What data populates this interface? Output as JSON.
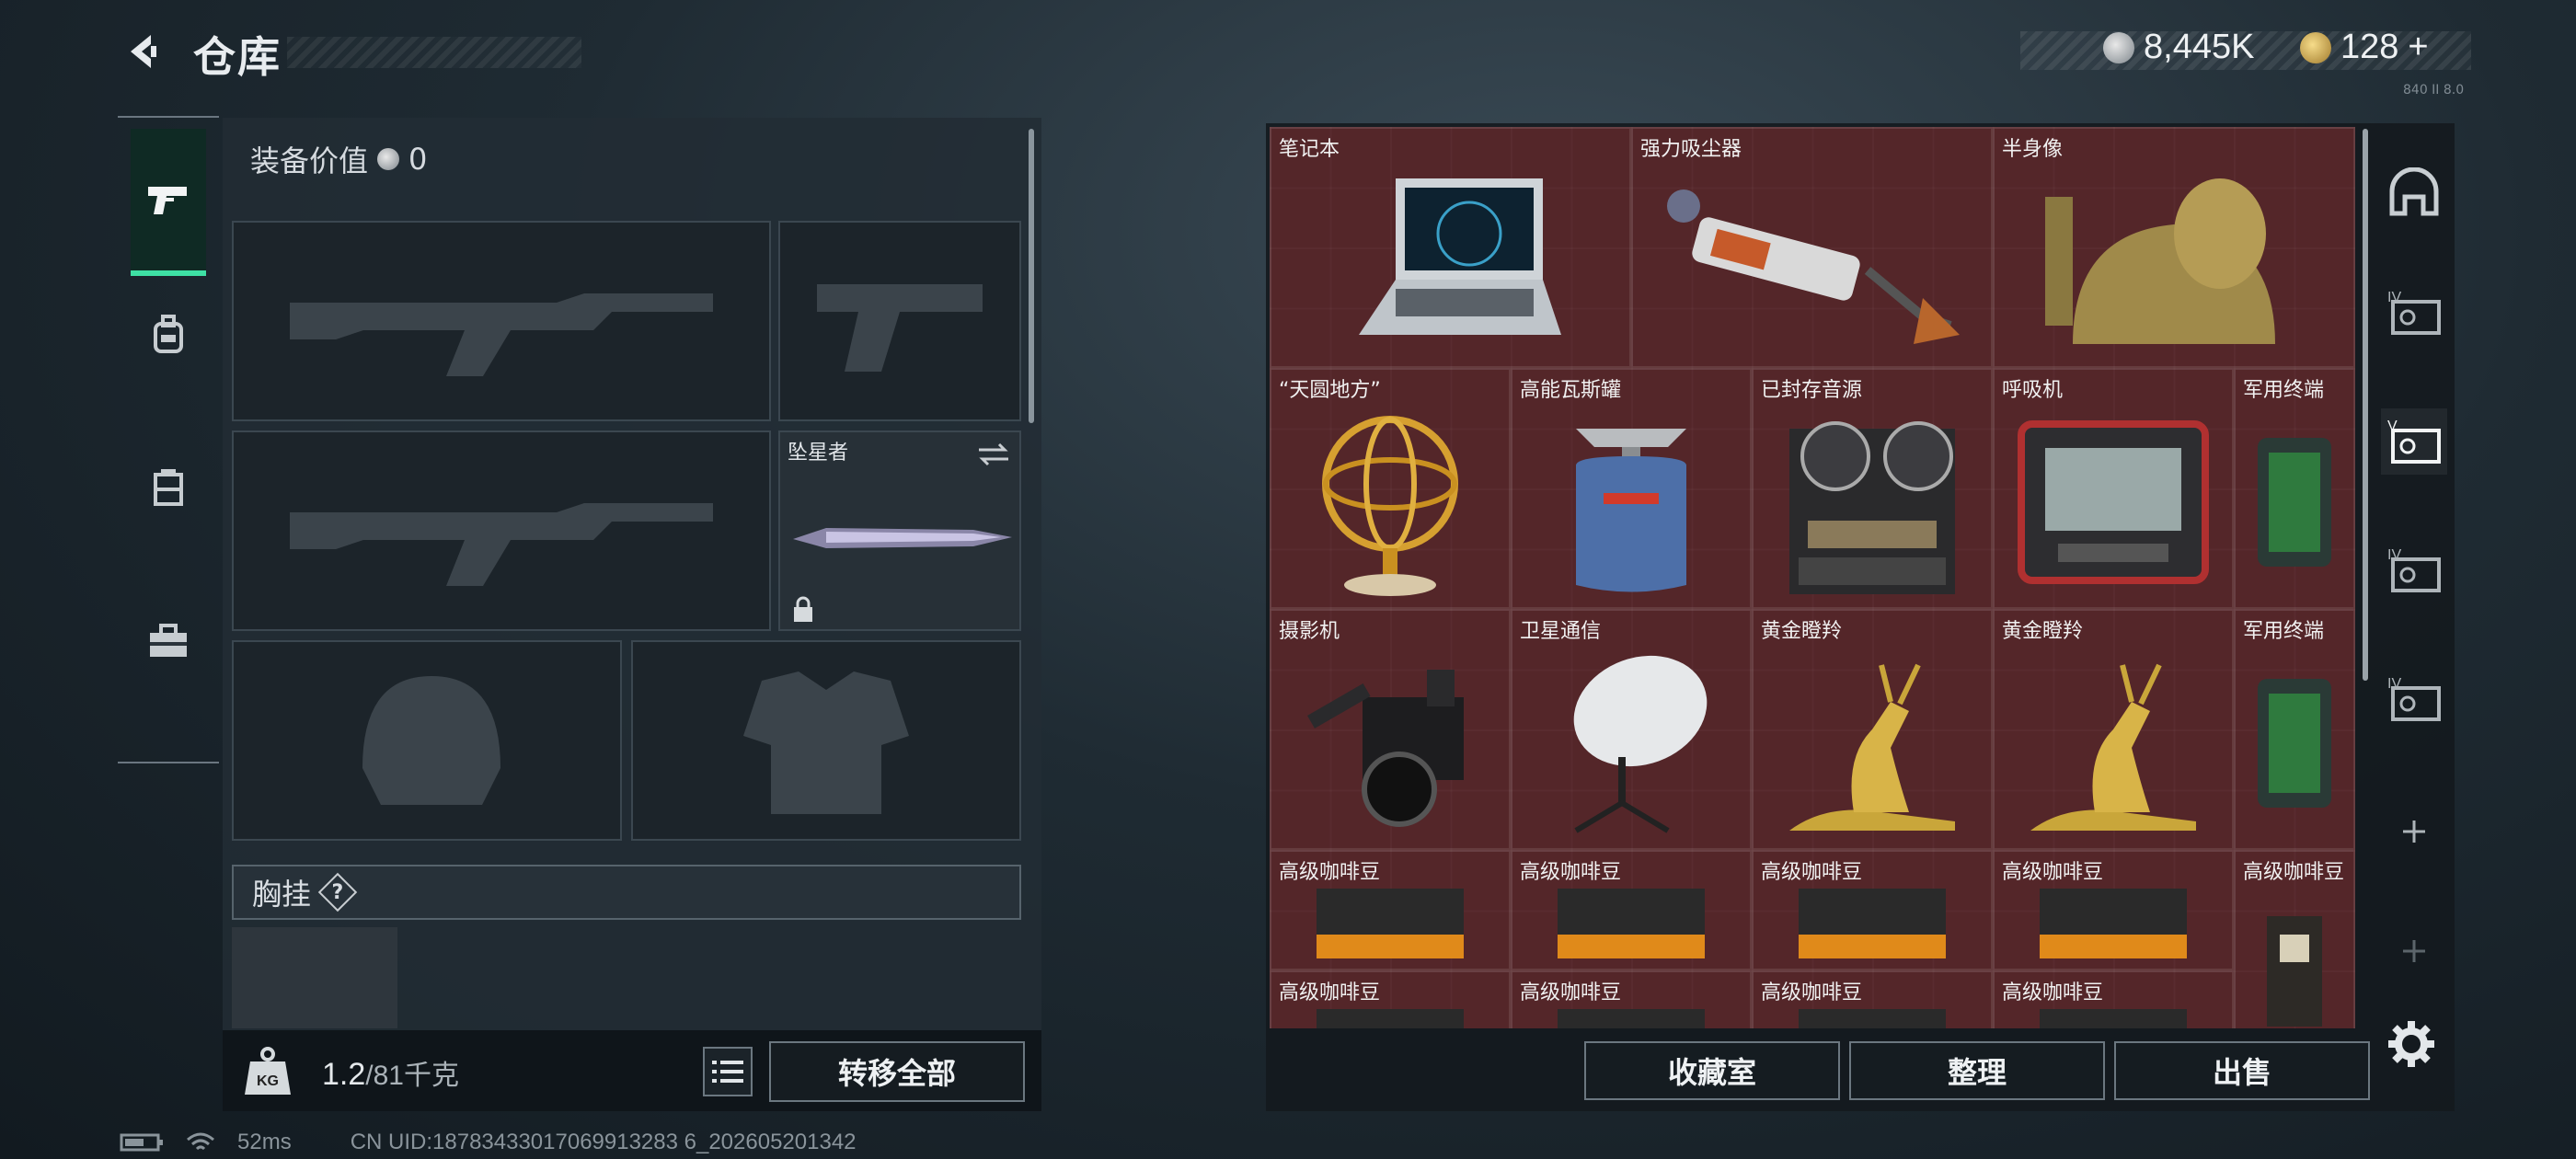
{
  "header": {
    "title": "仓库",
    "currencies": [
      {
        "icon": "silver-coin-icon",
        "value": "8,445K"
      },
      {
        "icon": "gold-coin-icon",
        "value": "128",
        "plus": "+"
      }
    ],
    "tiny_label": "840 II 8.0"
  },
  "equipment": {
    "value_label": "装备价值",
    "value": "0",
    "melee": {
      "name": "坠星者"
    },
    "chest_rig": {
      "label": "胸挂",
      "help": "?"
    },
    "weight": {
      "current": "1.2",
      "max": "/81千克"
    },
    "transfer_all_label": "转移全部"
  },
  "stash": {
    "items": [
      {
        "name": "笔记本"
      },
      {
        "name": "强力吸尘器"
      },
      {
        "name": "半身像"
      },
      {
        "name": "“天圆地方”"
      },
      {
        "name": "高能瓦斯罐"
      },
      {
        "name": "已封存音源"
      },
      {
        "name": "呼吸机"
      },
      {
        "name": "军用终端"
      },
      {
        "name": "摄影机"
      },
      {
        "name": "卫星通信"
      },
      {
        "name": "黄金瞪羚"
      },
      {
        "name": "黄金瞪羚"
      },
      {
        "name": "军用终端"
      },
      {
        "name": "高级咖啡豆"
      },
      {
        "name": "高级咖啡豆"
      },
      {
        "name": "高级咖啡豆"
      },
      {
        "name": "高级咖啡豆"
      },
      {
        "name": "高级咖啡豆"
      },
      {
        "name": "高级咖啡豆"
      },
      {
        "name": "高级咖啡豆"
      },
      {
        "name": "高级咖啡豆"
      },
      {
        "name": "高级咖啡豆"
      }
    ],
    "tabs": [
      {
        "label": "",
        "icon": "home-case-icon"
      },
      {
        "label": "IV",
        "icon": "case-tier-iv-icon"
      },
      {
        "label": "V",
        "icon": "case-tier-v-icon"
      },
      {
        "label": "IV",
        "icon": "case-tier-iv-icon"
      },
      {
        "label": "IV",
        "icon": "case-tier-iv-icon"
      }
    ],
    "collection_label": "收藏室",
    "organize_label": "整理",
    "sell_label": "出售"
  },
  "status": {
    "ping": "52ms",
    "uid": "CN UID:18783433017069913283 6_202605201342"
  },
  "colors": {
    "accent": "#3ee0a4",
    "stash_bg": "#5a2a2e",
    "panel_bg": "#222c34"
  }
}
